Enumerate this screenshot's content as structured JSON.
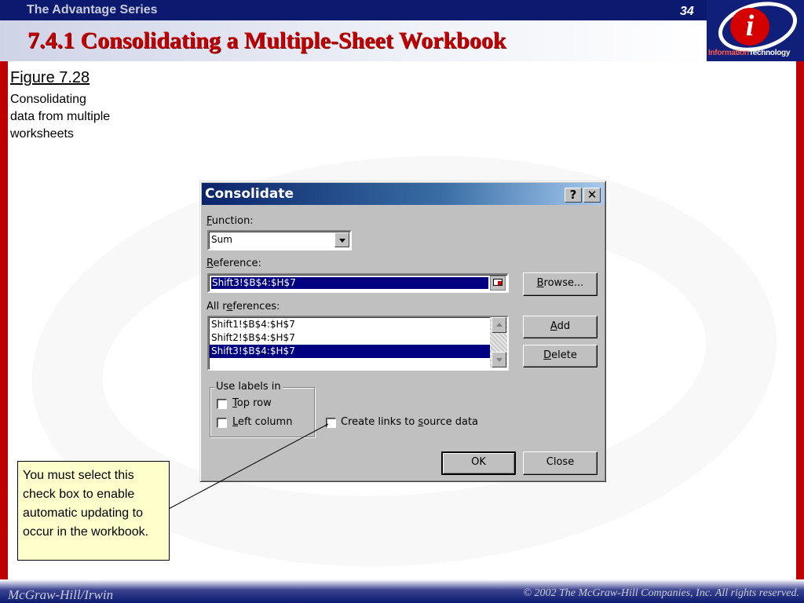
{
  "slide": {
    "series": "The Advantage Series",
    "page_number": "34",
    "title": "7.4.1 Consolidating a Multiple-Sheet Workbook",
    "logo_text_a": "Information",
    "logo_text_b": "Technology",
    "logo_letter": "i",
    "footer_left": "McGraw-Hill/Irwin",
    "footer_right": "© 2002  The McGraw-Hill Companies, Inc. All rights reserved."
  },
  "figure": {
    "title": "Figure 7.28",
    "caption": "Consolidating data from multiple worksheets"
  },
  "dialog": {
    "title": "Consolidate",
    "help_btn": "?",
    "close_btn": "✕",
    "function_label": "unction:",
    "function_label_key": "F",
    "function_value": "Sum",
    "reference_label": "eference:",
    "reference_label_key": "R",
    "reference_value": "Shift3!$B$4:$H$7",
    "all_refs_label_a": "All r",
    "all_refs_label_key": "e",
    "all_refs_label_b": "ferences:",
    "all_references": [
      "Shift1!$B$4:$H$7",
      "Shift2!$B$4:$H$7",
      "Shift3!$B$4:$H$7"
    ],
    "browse_button": "Browse...",
    "browse_key": "B",
    "browse_rest": "rowse...",
    "add_button_key": "A",
    "add_button_rest": "dd",
    "delete_button_key": "D",
    "delete_button_rest": "elete",
    "use_labels_group": "Use labels in",
    "top_row_key": "T",
    "top_row_rest": "op row",
    "left_column_key": "L",
    "left_column_rest": "eft column",
    "create_links_a": "Create links to ",
    "create_links_key": "s",
    "create_links_b": "ource data",
    "ok_button": "OK",
    "close_button": "Close"
  },
  "callout": {
    "text": "You must select this check box to enable automatic updating to occur in the workbook."
  },
  "colors": {
    "navy": "#0b1a6e",
    "title_red": "#c00000",
    "dialog_gray": "#c0c0c0",
    "selection": "#000080",
    "callout_bg": "#ffffcc"
  },
  "icons": [
    "help-icon",
    "close-icon",
    "dropdown-arrow-icon",
    "collapse-dialog-icon",
    "scroll-up-icon",
    "scroll-down-icon",
    "checkbox-icon"
  ]
}
